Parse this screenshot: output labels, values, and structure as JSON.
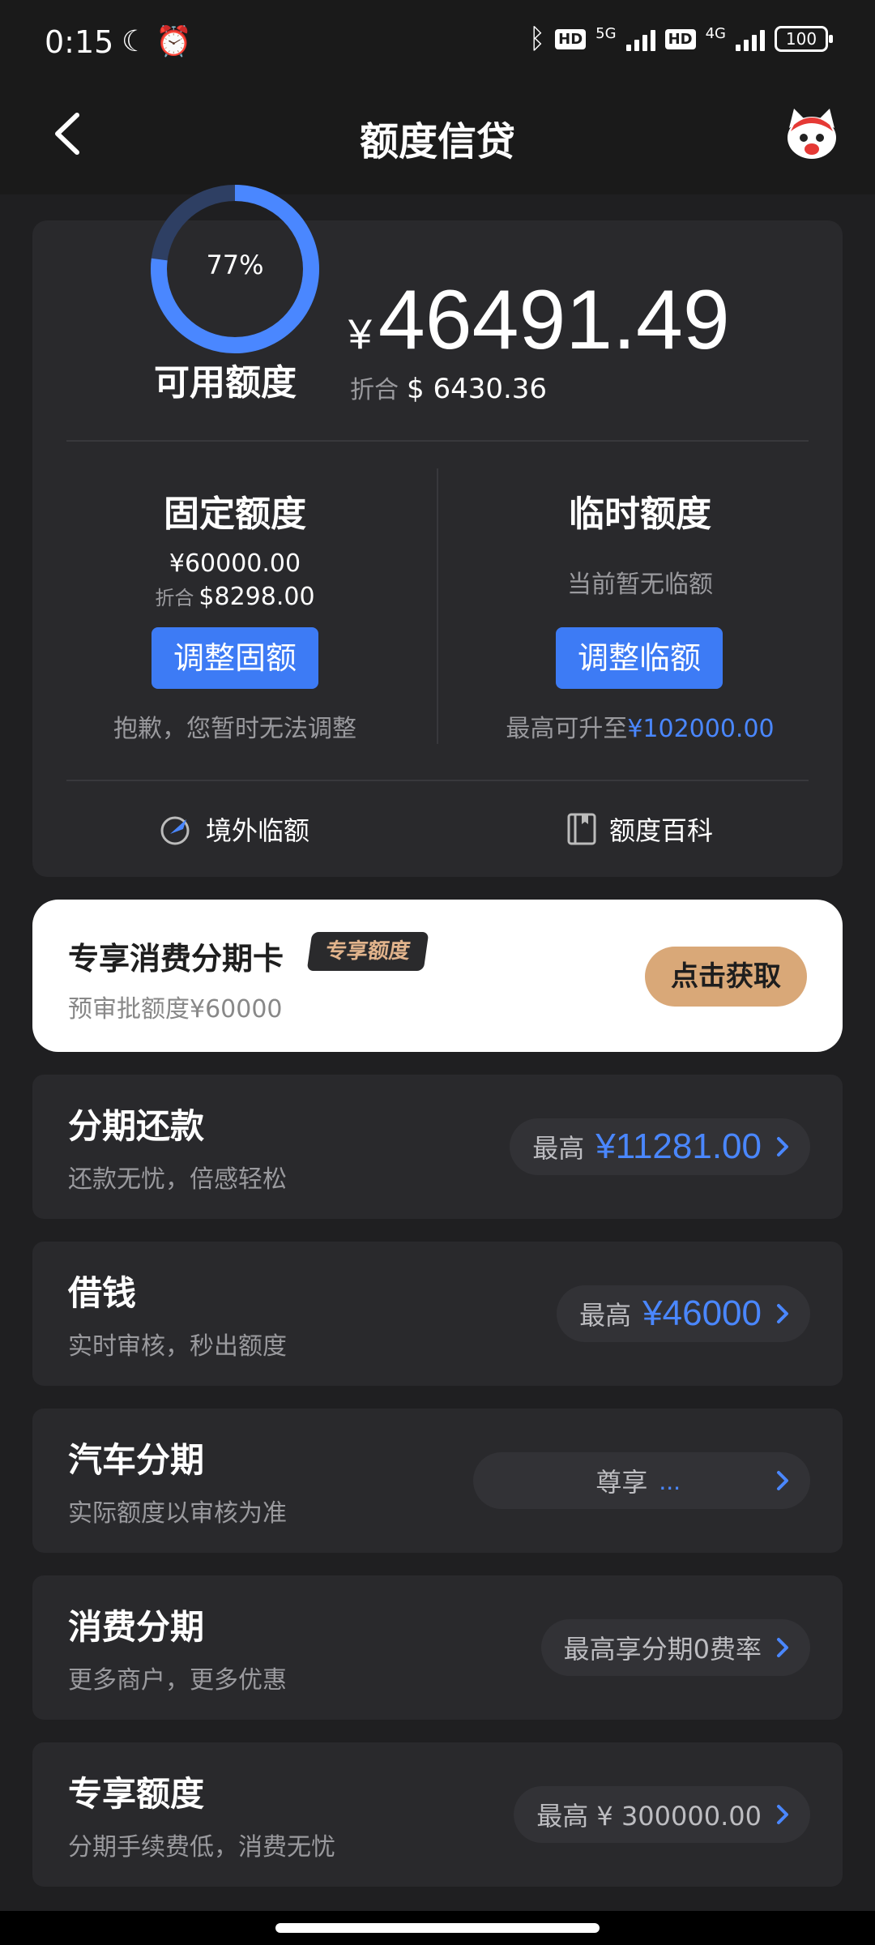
{
  "status": {
    "time": "0:15",
    "hd1": "HD",
    "net1": "5G",
    "hd2": "HD",
    "net2": "4G",
    "battery": "100"
  },
  "header": {
    "title": "额度信贷"
  },
  "credit": {
    "usage_percent_label": "77%",
    "usage_fraction": 0.77,
    "available_label": "可用额度",
    "currency_symbol": "¥",
    "available_amount": "46491.49",
    "converted_label": "折合",
    "converted_amount": "$ 6430.36",
    "fixed": {
      "title": "固定额度",
      "amount": "¥60000.00",
      "converted_label": "折合",
      "converted_amount": "$8298.00",
      "button": "调整固额",
      "hint": "抱歉，您暂时无法调整"
    },
    "temp": {
      "title": "临时额度",
      "status": "当前暂无临额",
      "button": "调整临额",
      "hint_prefix": "最高可升至",
      "hint_amount": "¥102000.00"
    },
    "links": {
      "overseas": "境外临额",
      "wiki": "额度百科"
    }
  },
  "promo": {
    "title": "专享消费分期卡",
    "badge": "专享额度",
    "subtitle": "预审批额度¥60000",
    "button": "点击获取"
  },
  "products": [
    {
      "title": "分期还款",
      "subtitle": "还款无忧，倍感轻松",
      "pill_label": "最高",
      "pill_value": "¥11281.00"
    },
    {
      "title": "借钱",
      "subtitle": "实时审核，秒出额度",
      "pill_label": "最高",
      "pill_value": "¥46000"
    },
    {
      "title": "汽车分期",
      "subtitle": "实际额度以审核为准",
      "pill_label": "尊享",
      "pill_value": "..."
    },
    {
      "title": "消费分期",
      "subtitle": "更多商户，更多优惠",
      "pill_label": "最高享分期0费率",
      "pill_value": ""
    },
    {
      "title": "专享额度",
      "subtitle": "分期手续费低，消费无忧",
      "pill_label": "最高 ¥ 300000.00",
      "pill_value": ""
    }
  ],
  "colors": {
    "accent_blue": "#3d7bf5",
    "promo_gold": "#d9a878",
    "panel_bg": "#29292c"
  }
}
